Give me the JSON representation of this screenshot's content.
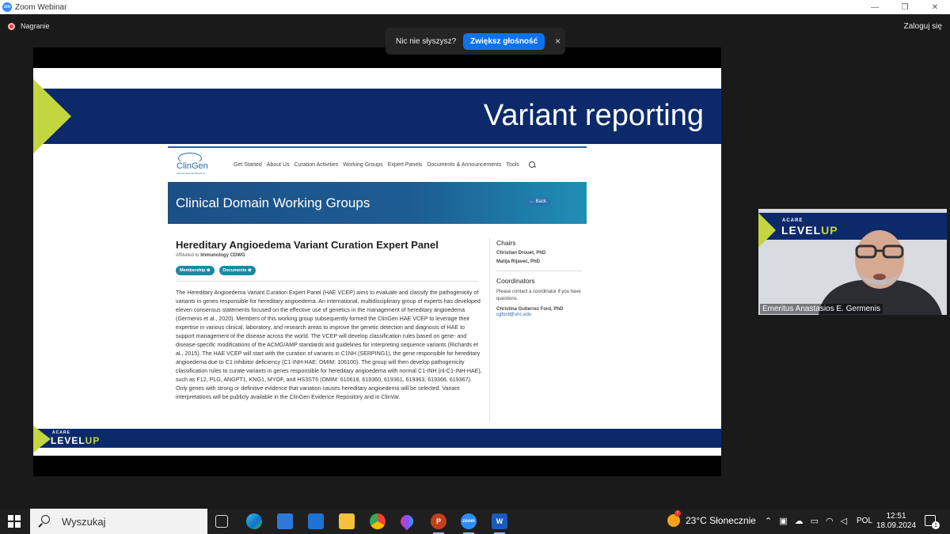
{
  "window": {
    "app_icon": "zm",
    "title": "Zoom Webinar",
    "minimize": "—",
    "restore": "❐",
    "close": "✕"
  },
  "zoom": {
    "recording_label": "Nagranie",
    "login_label": "Zaloguj się",
    "audio_banner": {
      "text": "Nic nie słyszysz?",
      "button": "Zwiększ głośność",
      "close": "×"
    }
  },
  "slide": {
    "title": "Variant reporting",
    "colors": {
      "navy": "#0c2a6a",
      "lime": "#c3d640"
    },
    "footer_logo": {
      "small": "ACARE",
      "level": "LEVEL",
      "up": "UP"
    }
  },
  "webpage": {
    "logo_text": "ClinGen",
    "logo_sub": "Clinical Genome Resource",
    "nav": [
      "Get Started",
      "About Us",
      "Curation Activities",
      "Working Groups",
      "Expert Panels",
      "Documents & Announcements",
      "Tools"
    ],
    "hero_title": "Clinical Domain Working Groups",
    "back_label": "← Back",
    "panel_title": "Hereditary Angioedema Variant Curation Expert Panel",
    "affiliated_prefix": "Affiliated to",
    "affiliated_group": "Immunology CDWG",
    "pills": [
      "Membership ⊕",
      "Documents ⊕"
    ],
    "description": "The Hereditary Angioedema Variant Curation Expert Panel (HAE VCEP) aims to evaluate and classify the pathogenicity of variants in genes responsible for hereditary angioedema. An international, multidisciplinary group of experts has developed eleven consensus statements focused on the effective use of genetics in the management of hereditary angioedema (Germenis et al., 2020). Members of this working group subsequently formed the ClinGen HAE VCEP to leverage their expertise in various clinical, laboratory, and research areas to improve the genetic detection and diagnosis of HAE to support management of the disease across the world. The VCEP will develop classification rules based on gene- and disease-specific modifications of the ACMG/AMP standards and guidelines for interpreting sequence variants (Richards et al., 2015). The HAE VCEP will start with the curation of variants in C1NH (SERPING1), the gene responsible for hereditary angioedema due to C1 inhibitor deficiency (C1-INH-HAE; OMIM: 106100). The group will then develop pathogenicity classification rules to curate variants in genes responsible for hereditary angioedema with normal C1-INH (nl-C1-INH-HAE), such as F12, PLG, ANGPT1, KNG1, MYOF, and HS3ST6 (OMIM: 610618, 619360, 619361, 619363, 619366, 619367). Only genes with strong or definitive evidence that variation causes hereditary angioedema will be selected. Variant interpretations will be publicly available in the ClinGen Evidence Repository and in ClinVar.",
    "chairs_heading": "Chairs",
    "chairs": [
      "Christian Drouet, PhD",
      "Matija Rijavec, PhD"
    ],
    "coordinators_heading": "Coordinators",
    "coordinators_note": "Please contact a coordinator if you have questions.",
    "coordinator_name": "Christina Gutierrez Ford, PhD",
    "coordinator_email": "cgford@unc.edu"
  },
  "video": {
    "acare": "ACARE",
    "level": "LEVEL",
    "up": "UP",
    "participant_name": "Emeritus Anastasios E. Germenis"
  },
  "taskbar": {
    "search_placeholder": "Wyszukaj",
    "apps": [
      "task-view",
      "edge",
      "store",
      "mail",
      "explorer",
      "chrome",
      "paint-3d",
      "powerpoint",
      "zoom",
      "word"
    ],
    "ppt_letter": "P",
    "word_letter": "W",
    "zoom_label": "zoom",
    "weather_badge": "!",
    "weather": "23°C  Słonecznie",
    "language": "POL",
    "time": "12:51",
    "date": "18.09.2024",
    "notification_count": "1"
  }
}
